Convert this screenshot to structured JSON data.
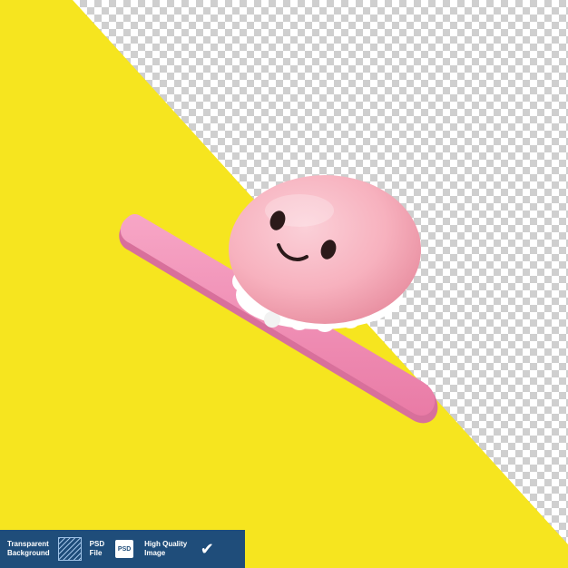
{
  "colors": {
    "yellow_background": "#f6e51f",
    "skateboard_pink": "#f28fb6",
    "character_pink": "#f7b1be",
    "frill_white": "#ffffff",
    "badge_bar_blue": "#1f4d7a"
  },
  "badge_bar": {
    "items": [
      {
        "label": "Transparent\nBackground",
        "icon": "hatched-square-icon"
      },
      {
        "label": "PSD\nFile",
        "icon": "psd-file-icon",
        "icon_text": "PSD"
      },
      {
        "label": "High Quality\nImage",
        "icon": "checkmark-icon"
      }
    ]
  }
}
